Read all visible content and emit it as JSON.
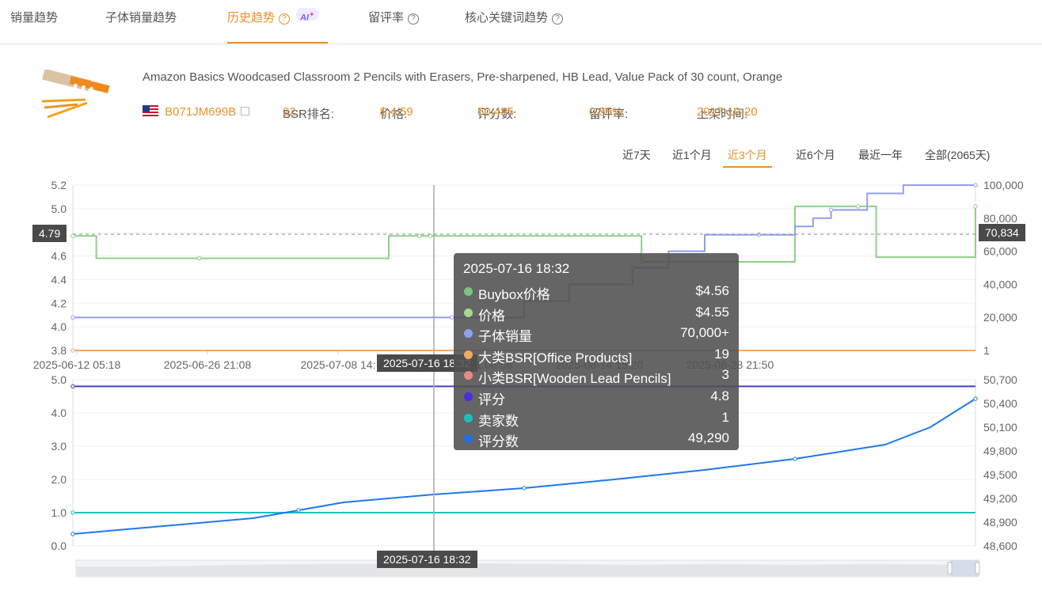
{
  "tabs": [
    {
      "label": "销量趋势",
      "help": false,
      "ai": false
    },
    {
      "label": "子体销量趋势",
      "help": false,
      "ai": false
    },
    {
      "label": "历史趋势",
      "help": true,
      "ai": true
    },
    {
      "label": "留评率",
      "help": true,
      "ai": false
    },
    {
      "label": "核心关键词趋势",
      "help": true,
      "ai": false
    }
  ],
  "ai_badge": "AI",
  "product": {
    "title": "Amazon Basics Woodcased Classroom 2 Pencils with Erasers, Pre-sharpened, HB Lead, Value Pack of 30 count, Orange",
    "asin": "B071JM699B",
    "bsr_label": "BSR排名: ",
    "bsr_value": "22",
    "price_label": "价格: ",
    "price_value": "$ 4.59",
    "reviews_label": "评分数: ",
    "reviews_value": "50,485",
    "review_rate_label": "留评率: ",
    "review_rate_value": "0.55%",
    "listed_label": "上架时间: ",
    "listed_value": "2017-10-20"
  },
  "ranges": [
    "近7天",
    "近1个月",
    "近3个月",
    "近6个月",
    "最近一年",
    "全部(2065天)"
  ],
  "active_range": 2,
  "axis_tags": {
    "left": "4.79",
    "right": "70,834",
    "crosshair_top": "2025-07-16 18:32",
    "crosshair_bottom": "2025-07-16 18:32"
  },
  "tooltip": {
    "title": "2025-07-16 18:32",
    "rows": [
      {
        "label": "Buybox价格",
        "value": "$4.56",
        "color": "#7cc47f"
      },
      {
        "label": "价格",
        "value": "$4.55",
        "color": "#a7d98f"
      },
      {
        "label": "子体销量",
        "value": "70,000+",
        "color": "#8fa0f0"
      },
      {
        "label": "大类BSR[Office Products]",
        "value": "19",
        "color": "#f4a860"
      },
      {
        "label": "小类BSR[Wooden Lead Pencils]",
        "value": "3",
        "color": "#e98a84"
      },
      {
        "label": "评分",
        "value": "4.8",
        "color": "#4a2de0"
      },
      {
        "label": "卖家数",
        "value": "1",
        "color": "#16c2bf"
      },
      {
        "label": "评分数",
        "value": "49,290",
        "color": "#1f6fea"
      }
    ]
  },
  "colors": {
    "accent": "#e8912a",
    "price": "#8fd08a",
    "child_sales": "#8f9ff0",
    "bsr": "#f4a860",
    "rating": "#4a3dc9",
    "sellers": "#16c2bf",
    "review_count": "#1f78ea"
  },
  "chart_data": [
    {
      "type": "line",
      "x_ticks": [
        "2025-06-12 05:18",
        "2025-06-26 21:08",
        "2025-07-08 14:",
        "2025-08-01 06:56",
        "2025-08-14 15:20",
        "2025-08-28 21:50"
      ],
      "left_axis": {
        "ticks": [
          "3.8",
          "4.0",
          "4.2",
          "4.4",
          "4.6",
          "4.8",
          "5.0",
          "5.2"
        ],
        "ylim": [
          3.8,
          5.2
        ]
      },
      "right_axis": {
        "ticks": [
          "1",
          "20,000",
          "40,000",
          "60,000",
          "80,000",
          "100,000"
        ],
        "ylim": [
          1,
          100000
        ]
      },
      "x_range": [
        0,
        100
      ],
      "series": [
        {
          "name": "价格",
          "axis": "left",
          "x": [
            0,
            1,
            2.6,
            14,
            28,
            35,
            38.4,
            38.8,
            39.2,
            39.6,
            40,
            60,
            63,
            78,
            80,
            87,
            89,
            96,
            100
          ],
          "y": [
            4.77,
            4.77,
            4.58,
            4.58,
            4.58,
            4.77,
            4.77,
            4.77,
            4.77,
            4.77,
            4.77,
            4.77,
            4.55,
            4.55,
            5.02,
            5.02,
            4.59,
            4.59,
            5.02
          ]
        },
        {
          "name": "子体销量",
          "axis": "right",
          "x": [
            0,
            14,
            28,
            42,
            50,
            55,
            62,
            66,
            70,
            76,
            80,
            82,
            84,
            88,
            92,
            100
          ],
          "y": [
            20000,
            20000,
            20000,
            20000,
            30000,
            40000,
            50000,
            60000,
            70000,
            70000,
            75000,
            80000,
            85000,
            95000,
            100000,
            100000
          ]
        },
        {
          "name": "大类BSR[Office Products]",
          "axis": "right",
          "x": [
            0,
            100
          ],
          "y": [
            1,
            1
          ]
        }
      ]
    },
    {
      "type": "line",
      "x_ticks": [],
      "left_axis": {
        "ticks": [
          "0.0",
          "1.0",
          "2.0",
          "3.0",
          "4.0",
          "5.0"
        ],
        "ylim": [
          0,
          5
        ]
      },
      "right_axis": {
        "ticks": [
          "48,600",
          "48,900",
          "49,200",
          "49,500",
          "49,800",
          "50,100",
          "50,400",
          "50,700"
        ],
        "ylim": [
          48600,
          50700
        ]
      },
      "x_range": [
        0,
        100
      ],
      "series": [
        {
          "name": "评分",
          "axis": "left",
          "x": [
            0,
            100
          ],
          "y": [
            4.8,
            4.8
          ]
        },
        {
          "name": "卖家数",
          "axis": "left",
          "x": [
            0,
            100
          ],
          "y": [
            1,
            1
          ]
        },
        {
          "name": "评分数",
          "axis": "right",
          "x": [
            0,
            10,
            20,
            25,
            30,
            40,
            50,
            60,
            70,
            80,
            90,
            95,
            100
          ],
          "y": [
            48750,
            48850,
            48950,
            49050,
            49150,
            49250,
            49330,
            49440,
            49560,
            49700,
            49880,
            50100,
            50460
          ]
        }
      ]
    }
  ]
}
